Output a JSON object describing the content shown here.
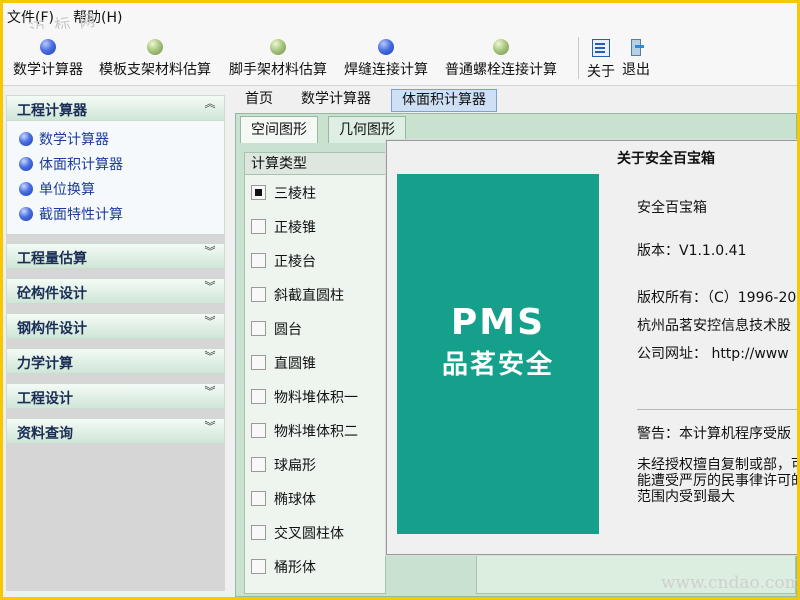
{
  "menubar": {
    "file": "文件(F)",
    "help": "帮助(H)",
    "watermark": "迈 标 网"
  },
  "toolbar": {
    "buttons": [
      {
        "label": "数学计算器",
        "icon": "blue-ball-icon"
      },
      {
        "label": "模板支架材料估算",
        "icon": "green-ball-icon"
      },
      {
        "label": "脚手架材料估算",
        "icon": "green-ball-icon"
      },
      {
        "label": "焊缝连接计算",
        "icon": "blue-ball-icon"
      },
      {
        "label": "普通螺栓连接计算",
        "icon": "green-ball-icon"
      }
    ],
    "about": "关于",
    "exit": "退出"
  },
  "sidebar": {
    "groups": [
      {
        "title": "工程计算器",
        "expanded": true,
        "items": [
          "数学计算器",
          "体面积计算器",
          "单位换算",
          "截面特性计算"
        ]
      },
      {
        "title": "工程量估算"
      },
      {
        "title": "砼构件设计"
      },
      {
        "title": "钢构件设计"
      },
      {
        "title": "力学计算"
      },
      {
        "title": "工程设计"
      },
      {
        "title": "资料查询"
      }
    ]
  },
  "maintabs": [
    "首页",
    "数学计算器",
    "体面积计算器"
  ],
  "subtabs": [
    "空间图形",
    "几何图形"
  ],
  "list": {
    "header": "计算类型",
    "items": [
      "三棱柱",
      "正棱锥",
      "正棱台",
      "斜截直圆柱",
      "圆台",
      "直圆锥",
      "物料堆体积一",
      "物料堆体积二",
      "球扁形",
      "椭球体",
      "交叉圆柱体",
      "桶形体"
    ],
    "checked_index": 0
  },
  "dialog": {
    "title": "关于安全百宝箱",
    "logo_en": "PMS",
    "logo_cn": "品茗安全",
    "app_name": "安全百宝箱",
    "version": "版本：V1.1.0.41",
    "copyright": "版权所有：（C）1996-20",
    "company": "杭州品茗安控信息技术股",
    "website": "公司网址：  http://www",
    "warning_title": "警告：本计算机程序受版",
    "warning_body": "未经授权擅自复制或部，可能遭受严厉的民事律许可的范围内受到最大"
  },
  "watermark": "www.cndao.com",
  "colors": {
    "frame": "#f5c800",
    "accent": "#14a08a",
    "panel": "#c9e2cf"
  }
}
